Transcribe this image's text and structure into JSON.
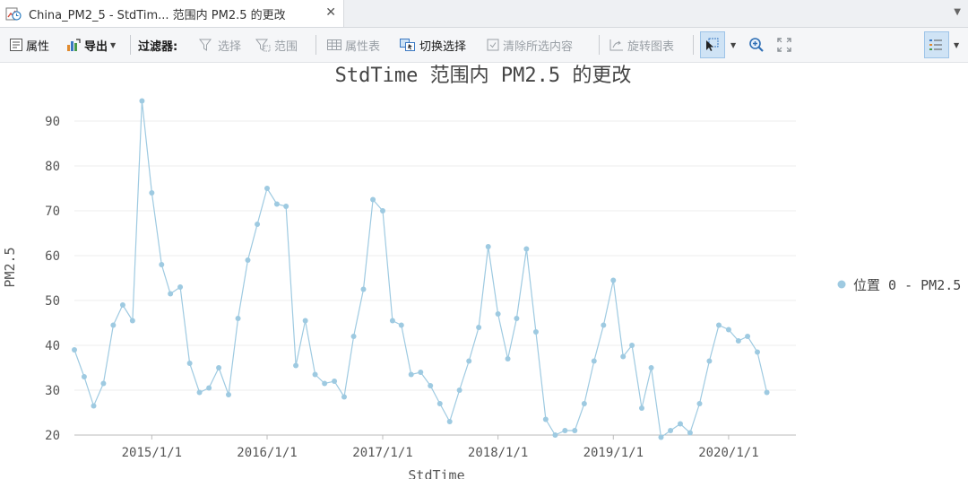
{
  "window": {
    "tab_title": "China_PM2_5 - StdTim... 范围内 PM2.5 的更改",
    "close_glyph": "✕",
    "dropdown_glyph": "▼"
  },
  "toolbar": {
    "properties": "属性",
    "export": "导出",
    "filter_label": "过滤器:",
    "select": "选择",
    "extent": "范围",
    "attribute_table": "属性表",
    "switch_selection": "切换选择",
    "clear_selection": "清除所选内容",
    "rotate_chart": "旋转图表"
  },
  "colors": {
    "series": "#9ecae1",
    "axis": "#bbbbbb",
    "grid": "#ececec",
    "text": "#555555"
  },
  "chart_data": {
    "type": "line",
    "title": "StdTime 范围内 PM2.5 的更改",
    "xlabel": "StdTime",
    "ylabel": "PM2.5",
    "ylim": [
      20,
      100
    ],
    "yticks": [
      20,
      30,
      40,
      50,
      60,
      70,
      80,
      90
    ],
    "xlim": [
      "2014-05-01",
      "2020-08-01"
    ],
    "xticks": [
      "2015/1/1",
      "2016/1/1",
      "2017/1/1",
      "2018/1/1",
      "2019/1/1",
      "2020/1/1"
    ],
    "grid": true,
    "legend_position": "right",
    "series": [
      {
        "name": "位置 0 - PM2.5",
        "x": [
          "2014-05",
          "2014-06",
          "2014-07",
          "2014-08",
          "2014-09",
          "2014-10",
          "2014-11",
          "2014-12",
          "2015-01",
          "2015-02",
          "2015-03",
          "2015-04",
          "2015-05",
          "2015-06",
          "2015-07",
          "2015-08",
          "2015-09",
          "2015-10",
          "2015-11",
          "2015-12",
          "2016-01",
          "2016-02",
          "2016-03",
          "2016-04",
          "2016-05",
          "2016-06",
          "2016-07",
          "2016-08",
          "2016-09",
          "2016-10",
          "2016-11",
          "2016-12",
          "2017-01",
          "2017-02",
          "2017-03",
          "2017-04",
          "2017-05",
          "2017-06",
          "2017-07",
          "2017-08",
          "2017-09",
          "2017-10",
          "2017-11",
          "2017-12",
          "2018-01",
          "2018-02",
          "2018-03",
          "2018-04",
          "2018-05",
          "2018-06",
          "2018-07",
          "2018-08",
          "2018-09",
          "2018-10",
          "2018-11",
          "2018-12",
          "2019-01",
          "2019-02",
          "2019-03",
          "2019-04",
          "2019-05",
          "2019-06",
          "2019-07",
          "2019-08",
          "2019-09",
          "2019-10",
          "2019-11",
          "2019-12",
          "2020-01",
          "2020-02",
          "2020-03",
          "2020-04",
          "2020-05"
        ],
        "values": [
          39,
          33,
          26.5,
          31.5,
          44.5,
          49,
          45.5,
          94.5,
          74,
          58,
          51.5,
          53,
          36,
          29.5,
          30.5,
          35,
          29,
          46,
          59,
          67,
          75,
          71.5,
          71,
          35.5,
          45.5,
          33.5,
          31.5,
          32,
          28.5,
          42,
          52.5,
          72.5,
          70,
          45.5,
          44.5,
          33.5,
          34,
          31,
          27,
          23,
          30,
          36.5,
          44,
          62,
          47,
          37,
          46,
          61.5,
          43,
          23.5,
          20,
          21,
          21,
          27,
          36.5,
          44.5,
          54.5,
          37.5,
          40,
          26,
          35,
          19.5,
          21,
          22.5,
          20.5,
          27,
          36.5,
          44.5,
          43.5,
          41,
          42,
          38.5,
          29.5
        ]
      }
    ]
  }
}
